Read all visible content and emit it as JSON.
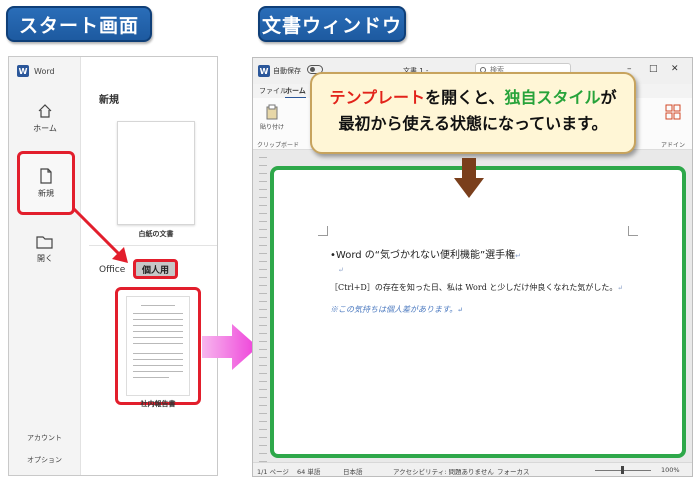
{
  "labels": {
    "start_screen": "スタート画面",
    "document_window": "文書ウィンドウ"
  },
  "start": {
    "app_name": "Word",
    "nav": [
      {
        "label": "ホーム",
        "icon": "home-icon"
      },
      {
        "label": "新規",
        "icon": "new-document-icon",
        "selected": true
      },
      {
        "label": "開く",
        "icon": "folder-icon"
      }
    ],
    "nav_bottom": [
      "アカウント",
      "オプション"
    ],
    "section_title": "新規",
    "blank_doc_caption": "白紙の文書",
    "tabs": {
      "office": "Office",
      "personal": "個人用"
    },
    "template_caption": "社内報告書"
  },
  "docwin": {
    "autosave": "自動保存",
    "title": "文書 1 -",
    "search_placeholder": "検索",
    "ribbon_tabs": [
      "ファイル",
      "ホーム"
    ],
    "paste": "貼り付け",
    "clipboard": "クリップボード",
    "addin": "アドイン",
    "document": {
      "heading": "Word の“気づかれない便利機能”選手権",
      "return_mark": "↵",
      "body": "［Ctrl+D］の存在を知った日、私は Word と少しだけ仲良くなれた気がした。",
      "note": "※この気持ちは個人差があります。"
    },
    "status": {
      "page": "1/1 ページ",
      "words": "64 単語",
      "language": "日本語",
      "accessibility": "アクセシビリティ: 問題ありません",
      "focus": "フォーカス",
      "zoom": "100%"
    }
  },
  "callout": {
    "part1": "テンプレート",
    "part2": "を開くと、",
    "part3": "独自スタイル",
    "part4": "が",
    "line2": "最初から使える状態になっています。"
  },
  "colors": {
    "label_blue": "#1d5aa0",
    "highlight_red": "#e21e2c",
    "page_border_green": "#2ea84a",
    "callout_bg": "#fff6d6"
  }
}
